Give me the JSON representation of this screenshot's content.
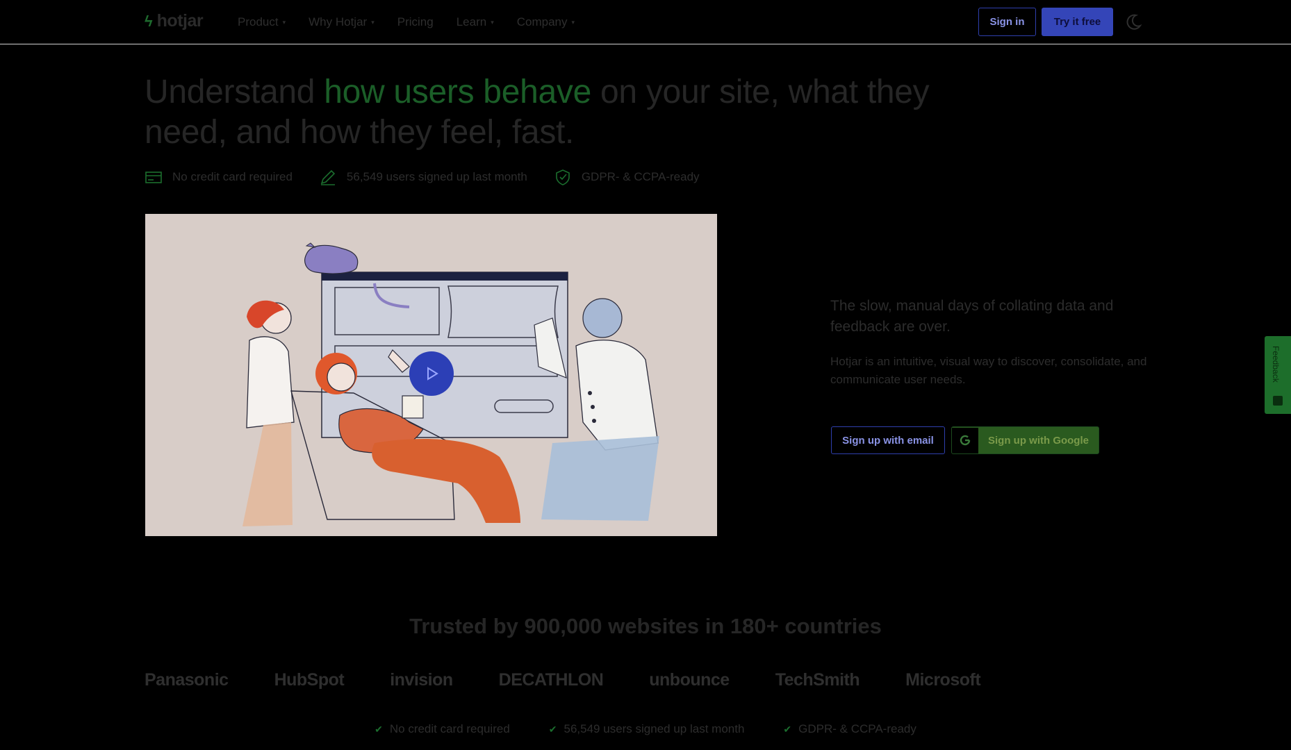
{
  "nav": {
    "logo_text": "hotjar",
    "menu": [
      {
        "label": "Product",
        "has_caret": true
      },
      {
        "label": "Why Hotjar",
        "has_caret": true
      },
      {
        "label": "Pricing",
        "has_caret": false
      },
      {
        "label": "Learn",
        "has_caret": true
      },
      {
        "label": "Company",
        "has_caret": true
      }
    ],
    "sign_in": "Sign in",
    "try_free": "Try it free",
    "theme_icon": "moon-icon"
  },
  "hero": {
    "headline_pre": "Understand ",
    "headline_highlight": "how users behave",
    "headline_post": " on your site, what they need, and how they feel, fast.",
    "badges": [
      {
        "icon": "credit-card-icon",
        "label": "No credit card required"
      },
      {
        "icon": "pencil-icon",
        "label": "56,549 users signed up last month"
      },
      {
        "icon": "shield-check-icon",
        "label": "GDPR- & CCPA-ready"
      }
    ],
    "subhead": "The slow, manual days of collating data and feedback are over.",
    "description": "Hotjar is an intuitive, visual way to discover, consolidate, and communicate user needs.",
    "signup_email": "Sign up with email",
    "signup_google": "Sign up with Google"
  },
  "feedback_tab": {
    "label": "Feedback"
  },
  "trusted": {
    "title": "Trusted by 900,000 websites in 180+ countries",
    "logos": [
      "Panasonic",
      "HubSpot",
      "invision",
      "DECATHLON",
      "unbounce",
      "TechSmith",
      "Microsoft"
    ]
  },
  "bottom_badges": [
    "No credit card required",
    "56,549 users signed up last month",
    "GDPR- & CCPA-ready"
  ],
  "colors": {
    "accent_blue": "#3445b8",
    "brand_green": "#1b5e28",
    "background": "#000000"
  }
}
